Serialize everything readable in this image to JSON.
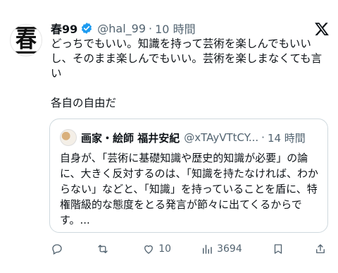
{
  "post": {
    "author_name": "春99",
    "handle": "@hal_99",
    "separator": "·",
    "time": "10 時間",
    "avatar_text": "春",
    "body_lines": [
      "どっちでもいい。知識を持って芸術を楽しんでもいいし、そのまま楽しんでもいい。芸術を楽しまなくても言い",
      "各自の自由だ"
    ]
  },
  "quote": {
    "author_name": "画家・絵師 福井安紀",
    "handle": "@xTAyVTtCY...",
    "separator": "·",
    "time": "14 時間",
    "body": "自身が、「芸術に基礎知識や歴史的知識が必要」の論に、大きく反対するのは、「知識を持たなければ、わからない」などと、「知識」を持っていることを盾に、特権階級的な態度をとる発言が節々に出てくるからです。..."
  },
  "actions": {
    "reply_count": "",
    "repost_count": "",
    "like_count": "10",
    "views_count": "3694"
  },
  "colors": {
    "verified": "#1d9bf0",
    "muted": "#536471",
    "border": "#cfd9de"
  }
}
